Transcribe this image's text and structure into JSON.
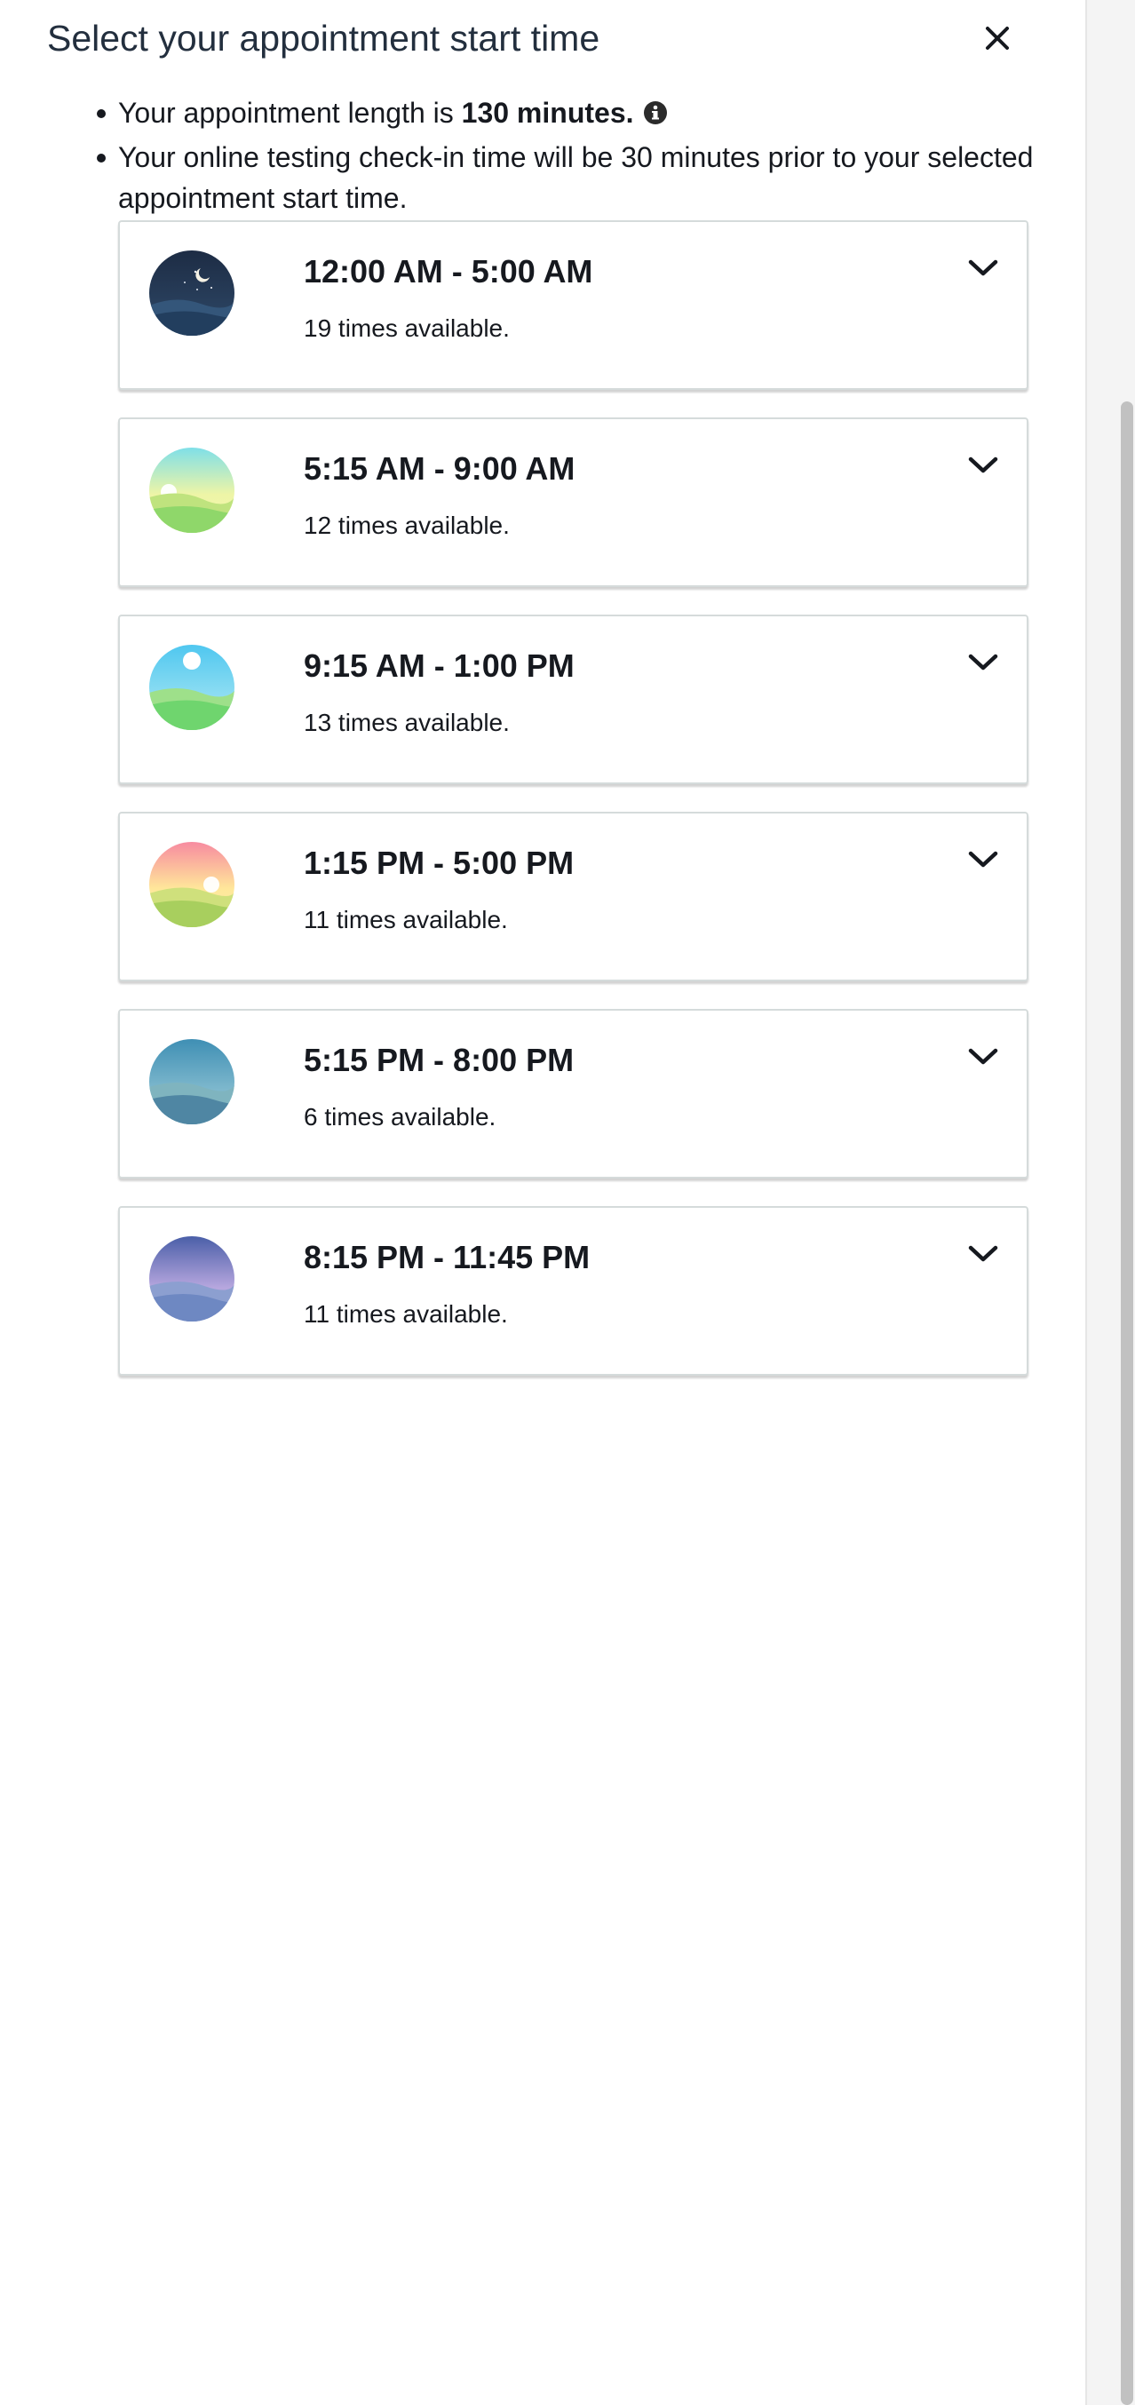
{
  "modal": {
    "title": "Select your appointment start time",
    "close_icon": "close-icon"
  },
  "info": {
    "length_prefix": "Your appointment length is ",
    "length_value": "130 minutes.",
    "info_icon": "info-icon",
    "checkin_text": "Your online testing check-in time will be 30 minutes prior to your selected appointment start time."
  },
  "slots": [
    {
      "range": "12:00 AM - 5:00 AM",
      "count": "19 times available.",
      "icon": "night-moon-icon",
      "expand_icon": "chevron-down-icon"
    },
    {
      "range": "5:15 AM - 9:00 AM",
      "count": "12 times available.",
      "icon": "sunrise-icon",
      "expand_icon": "chevron-down-icon"
    },
    {
      "range": "9:15 AM - 1:00 PM",
      "count": "13 times available.",
      "icon": "midday-sun-icon",
      "expand_icon": "chevron-down-icon"
    },
    {
      "range": "1:15 PM - 5:00 PM",
      "count": "11 times available.",
      "icon": "afternoon-sun-icon",
      "expand_icon": "chevron-down-icon"
    },
    {
      "range": "5:15 PM - 8:00 PM",
      "count": "6 times available.",
      "icon": "evening-icon",
      "expand_icon": "chevron-down-icon"
    },
    {
      "range": "8:15 PM - 11:45 PM",
      "count": "11 times available.",
      "icon": "dusk-icon",
      "expand_icon": "chevron-down-icon"
    }
  ],
  "colors": {
    "text": "#16191f",
    "card_border": "#d5dbdb",
    "title": "#232f3e"
  }
}
